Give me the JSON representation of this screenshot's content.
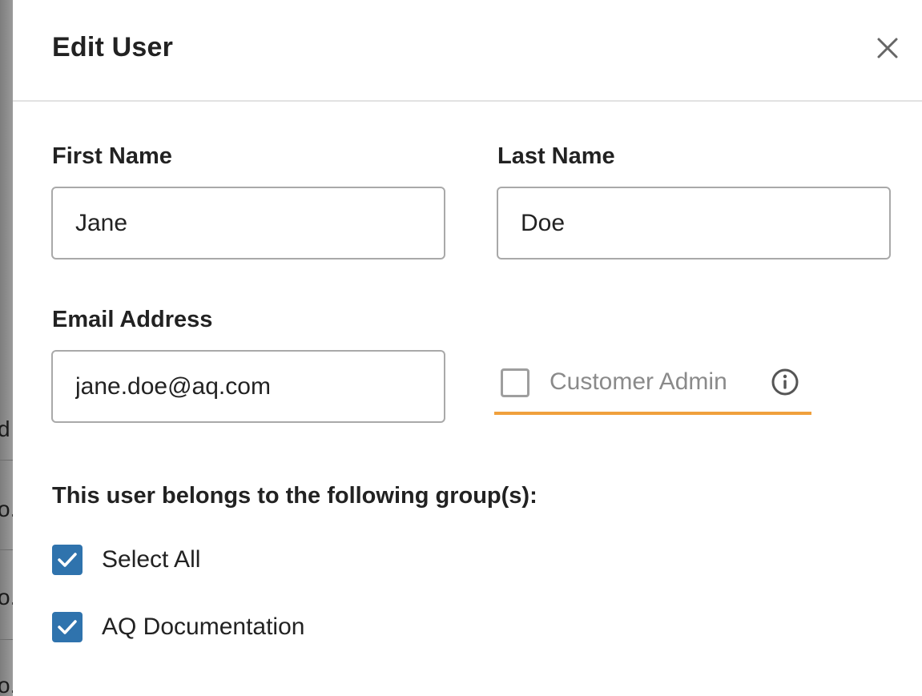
{
  "dialog": {
    "title": "Edit User"
  },
  "form": {
    "first_name": {
      "label": "First Name",
      "value": "Jane"
    },
    "last_name": {
      "label": "Last Name",
      "value": "Doe"
    },
    "email": {
      "label": "Email Address",
      "value": "jane.doe@aq.com"
    },
    "customer_admin": {
      "label": "Customer Admin",
      "checked": false
    }
  },
  "groups": {
    "heading": "This user belongs to the following group(s):",
    "items": [
      {
        "label": "Select All",
        "checked": true
      },
      {
        "label": "AQ Documentation",
        "checked": true
      }
    ]
  },
  "background": {
    "fragments": [
      "d",
      "o.",
      "o.",
      "o."
    ]
  },
  "colors": {
    "accent_underline": "#f0a03c",
    "checkbox_checked": "#2f73ad",
    "input_border": "#a9a9a9"
  },
  "icons": {
    "close": "close-icon",
    "info": "info-icon",
    "check": "checkmark-icon"
  }
}
